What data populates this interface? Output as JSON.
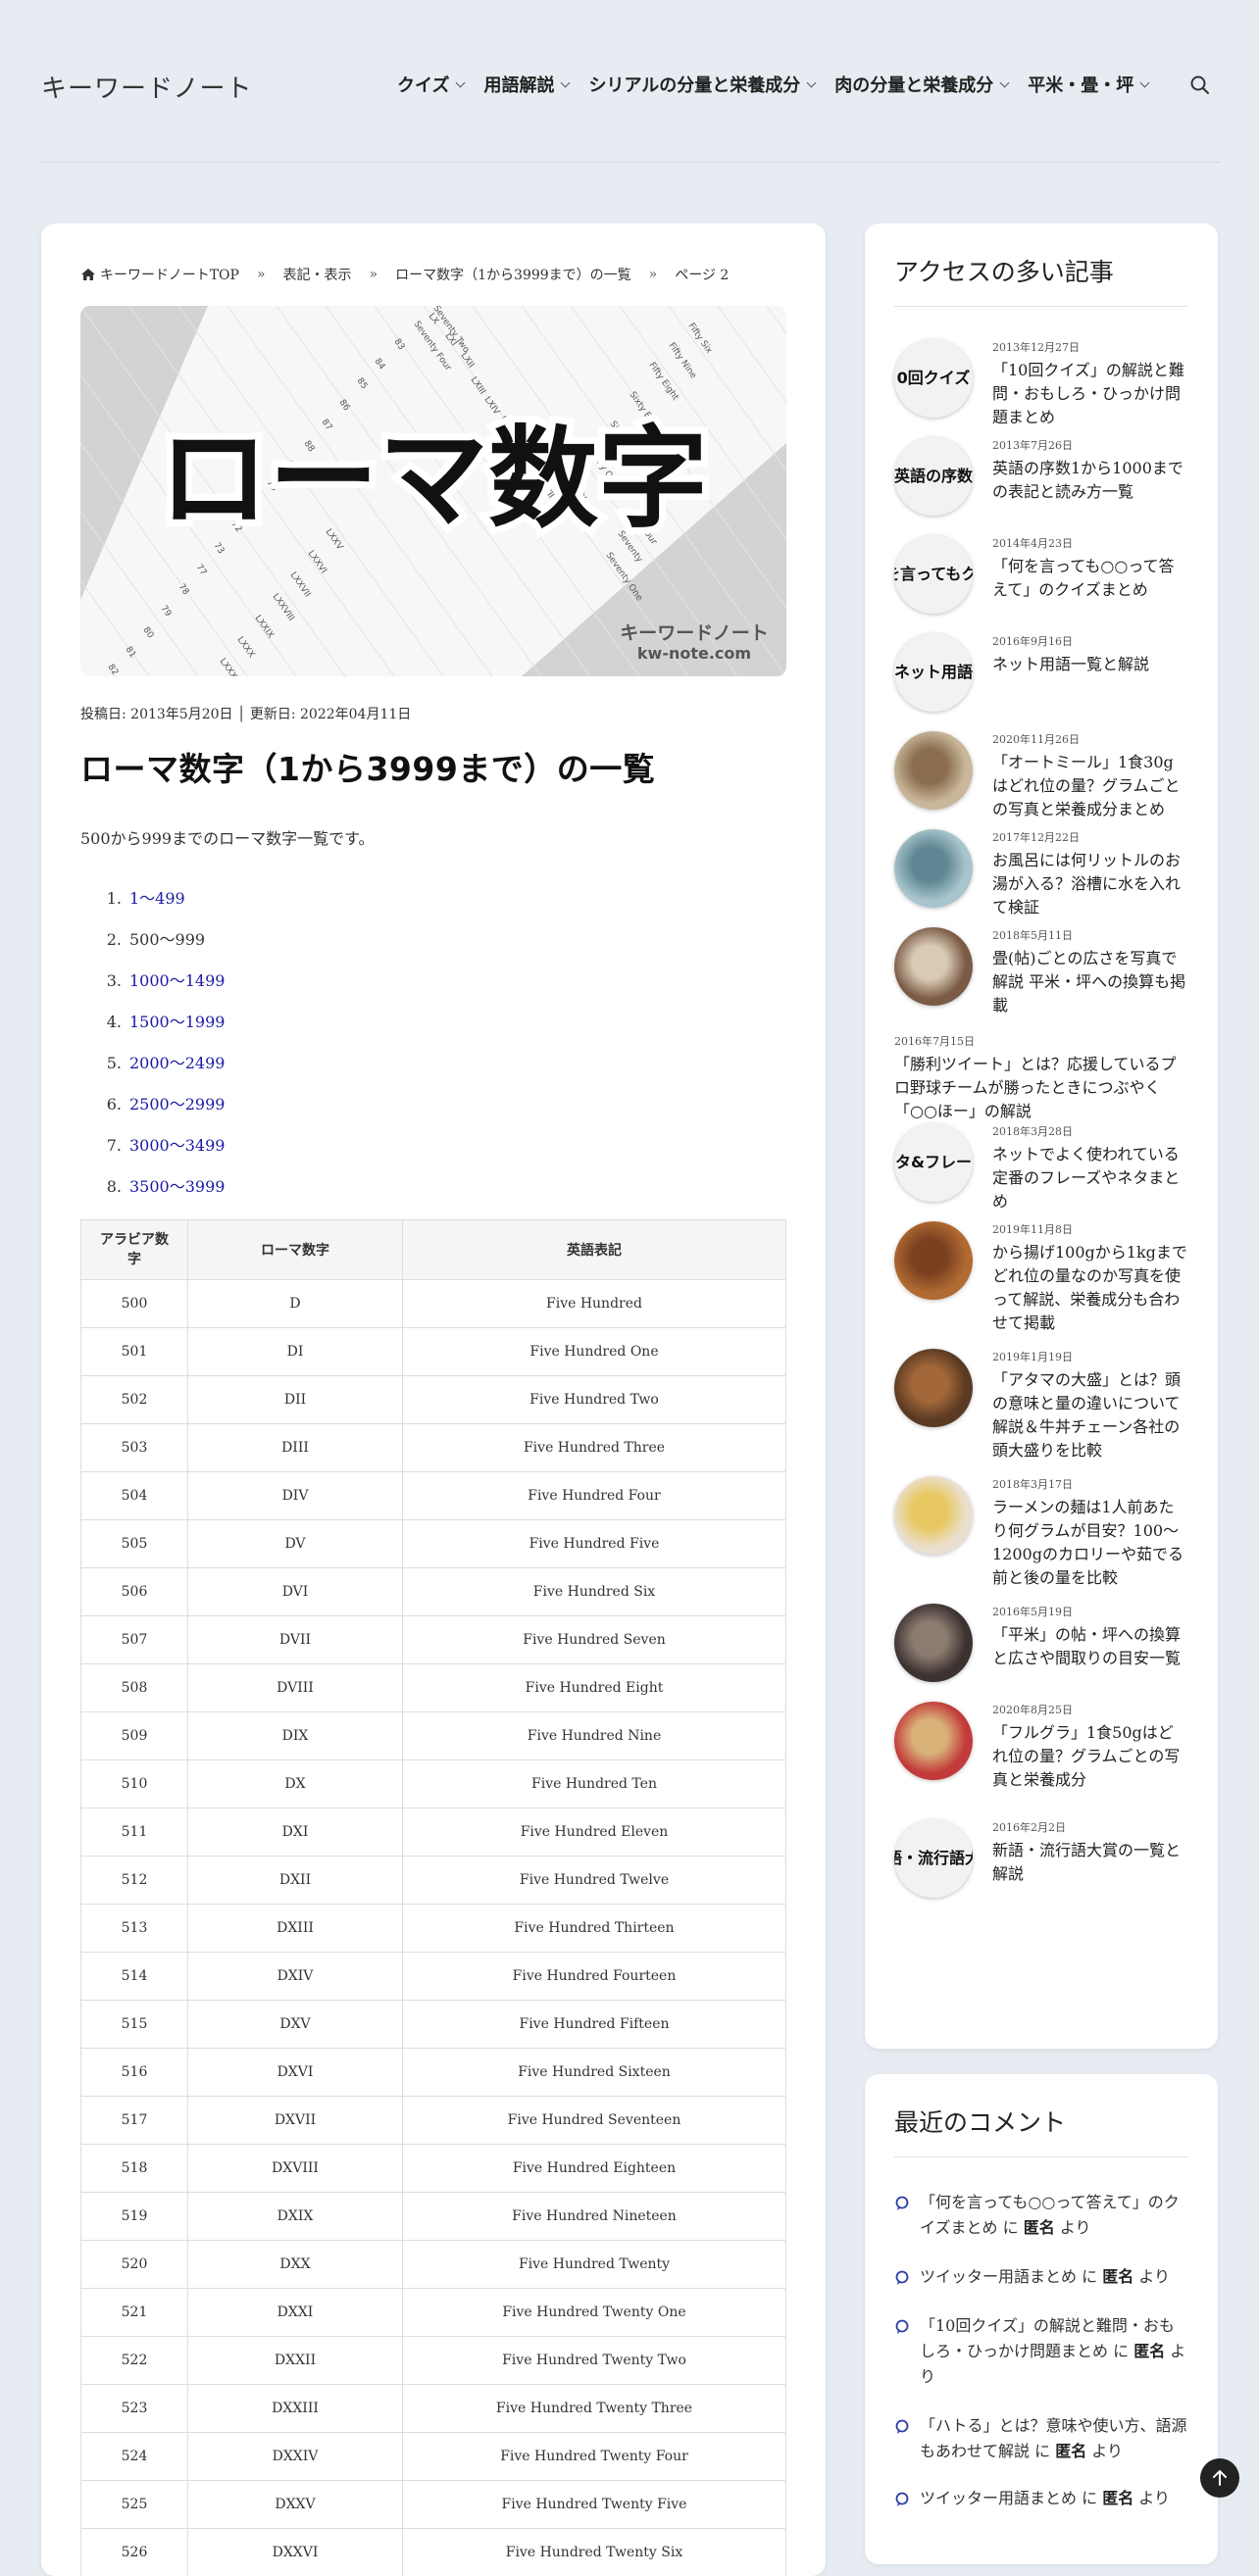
{
  "header": {
    "site_title": "キーワードノート",
    "nav": [
      "クイズ",
      "用語解説",
      "シリアルの分量と栄養成分",
      "肉の分量と栄養成分",
      "平米・畳・坪"
    ]
  },
  "breadcrumb": {
    "home": "キーワードノートTOP",
    "sep": "»",
    "items": [
      "表記・表示",
      "ローマ数字（1から3999まで）の一覧",
      "ページ 2"
    ]
  },
  "hero": {
    "title": "ローマ数字",
    "brand": "キーワードノート",
    "domain": "kw-note.com",
    "bg_words": [
      "LX",
      "LXI",
      "LXII",
      "LXIII",
      "LXIV",
      "LXV",
      "LXVI",
      "LXVII",
      "LXVIII",
      "LXIX",
      "Sixty",
      "Sixty One",
      "Sixty Two",
      "Sixty Eight",
      "Fifty Eight",
      "Fifty Nine",
      "Fifty Six",
      "Fifty Four",
      "Seventy",
      "Seventy One",
      "Seventy Two",
      "Seventy Four",
      "83",
      "84",
      "85",
      "86",
      "87",
      "88",
      "69",
      "70",
      "71",
      "72",
      "73",
      "77",
      "78",
      "79",
      "80",
      "81",
      "82",
      "LXXV",
      "LXXVI",
      "LXXVII",
      "LXXVIII",
      "LXXIX",
      "LXXX",
      "LXXXI"
    ]
  },
  "post": {
    "dates": "投稿日:  2013年5月20日 │ 更新日:  2022年04月11日",
    "title": "ローマ数字（1から3999まで）の一覧",
    "intro": "500から999までのローマ数字一覧です。",
    "ranges": [
      {
        "n": "1.",
        "label": "1～499",
        "link": true
      },
      {
        "n": "2.",
        "label": "500～999",
        "link": false
      },
      {
        "n": "3.",
        "label": "1000～1499",
        "link": true
      },
      {
        "n": "4.",
        "label": "1500～1999",
        "link": true
      },
      {
        "n": "5.",
        "label": "2000～2499",
        "link": true
      },
      {
        "n": "6.",
        "label": "2500～2999",
        "link": true
      },
      {
        "n": "7.",
        "label": "3000～3499",
        "link": true
      },
      {
        "n": "8.",
        "label": "3500～3999",
        "link": true
      }
    ]
  },
  "table": {
    "headers": [
      "アラビア数字",
      "ローマ数字",
      "英語表記"
    ],
    "rows": [
      [
        "500",
        "D",
        "Five Hundred"
      ],
      [
        "501",
        "DI",
        "Five Hundred One"
      ],
      [
        "502",
        "DII",
        "Five Hundred Two"
      ],
      [
        "503",
        "DIII",
        "Five Hundred Three"
      ],
      [
        "504",
        "DIV",
        "Five Hundred Four"
      ],
      [
        "505",
        "DV",
        "Five Hundred Five"
      ],
      [
        "506",
        "DVI",
        "Five Hundred Six"
      ],
      [
        "507",
        "DVII",
        "Five Hundred Seven"
      ],
      [
        "508",
        "DVIII",
        "Five Hundred Eight"
      ],
      [
        "509",
        "DIX",
        "Five Hundred Nine"
      ],
      [
        "510",
        "DX",
        "Five Hundred Ten"
      ],
      [
        "511",
        "DXI",
        "Five Hundred Eleven"
      ],
      [
        "512",
        "DXII",
        "Five Hundred Twelve"
      ],
      [
        "513",
        "DXIII",
        "Five Hundred Thirteen"
      ],
      [
        "514",
        "DXIV",
        "Five Hundred Fourteen"
      ],
      [
        "515",
        "DXV",
        "Five Hundred Fifteen"
      ],
      [
        "516",
        "DXVI",
        "Five Hundred Sixteen"
      ],
      [
        "517",
        "DXVII",
        "Five Hundred Seventeen"
      ],
      [
        "518",
        "DXVIII",
        "Five Hundred Eighteen"
      ],
      [
        "519",
        "DXIX",
        "Five Hundred Nineteen"
      ],
      [
        "520",
        "DXX",
        "Five Hundred Twenty"
      ],
      [
        "521",
        "DXXI",
        "Five Hundred Twenty One"
      ],
      [
        "522",
        "DXXII",
        "Five Hundred Twenty Two"
      ],
      [
        "523",
        "DXXIII",
        "Five Hundred Twenty Three"
      ],
      [
        "524",
        "DXXIV",
        "Five Hundred Twenty Four"
      ],
      [
        "525",
        "DXXV",
        "Five Hundred Twenty Five"
      ],
      [
        "526",
        "DXXVI",
        "Five Hundred Twenty Six"
      ]
    ]
  },
  "popular": {
    "heading": "アクセスの多い記事",
    "items": [
      {
        "date": "2013年12月27日",
        "title": "「10回クイズ」の解説と難問・おもしろ・ひっかけ問題まとめ",
        "thumb_text": "0回クイズ",
        "thumb": "text"
      },
      {
        "date": "2013年7月26日",
        "title": "英語の序数1から1000までの表記と読み方一覧",
        "thumb_text": "英語の序数",
        "thumb": "text"
      },
      {
        "date": "2014年4月23日",
        "title": "「何を言っても○○って答えて」のクイズまとめ",
        "thumb_text": "を言ってもクイ",
        "thumb": "text"
      },
      {
        "date": "2016年9月16日",
        "title": "ネット用語一覧と解説",
        "thumb_text": "ネット用語",
        "thumb": "text"
      },
      {
        "date": "2020年11月26日",
        "title": "「オートミール」1食30gはどれ位の量？グラムごとの写真と栄養成分まとめ",
        "thumb_text": "",
        "thumb": "oat"
      },
      {
        "date": "2017年12月22日",
        "title": "お風呂には何リットルのお湯が入る？浴槽に水を入れて検証",
        "thumb_text": "",
        "thumb": "bath"
      },
      {
        "date": "2018年5月11日",
        "title": "畳(帖)ごとの広さを写真で解説 平米・坪への換算も掲載",
        "thumb_text": "",
        "thumb": "room"
      },
      {
        "date": "2016年7月15日",
        "title": "「勝利ツイート」とは？応援しているプロ野球チームが勝ったときにつぶやく「○○ほー」の解説",
        "thumb_text": "",
        "thumb": "none"
      },
      {
        "date": "2018年3月28日",
        "title": "ネットでよく使われている定番のフレーズやネタまとめ",
        "thumb_text": "タ&フレー",
        "thumb": "text"
      },
      {
        "date": "2019年11月8日",
        "title": "から揚げ100gから1kgまでどれ位の量なのか写真を使って解説、栄養成分も合わせて掲載",
        "thumb_text": "",
        "thumb": "karaage"
      },
      {
        "date": "2019年1月19日",
        "title": "「アタマの大盛」とは？頭の意味と量の違いについて解説＆牛丼チェーン各社の頭大盛りを比較",
        "thumb_text": "",
        "thumb": "gyudon"
      },
      {
        "date": "2018年3月17日",
        "title": "ラーメンの麺は1人前あたり何グラムが目安？100～1200gのカロリーや茹でる前と後の量を比較",
        "thumb_text": "",
        "thumb": "noodle"
      },
      {
        "date": "2016年5月19日",
        "title": "「平米」の帖・坪への換算と広さや間取りの目安一覧",
        "thumb_text": "",
        "thumb": "floor"
      },
      {
        "date": "2020年8月25日",
        "title": "「フルグラ」1食50gはどれ位の量？グラムごとの写真と栄養成分",
        "thumb_text": "",
        "thumb": "granola"
      },
      {
        "date": "2016年2月2日",
        "title": "新語・流行語大賞の一覧と解説",
        "thumb_text": "語・流行語大",
        "thumb": "text"
      }
    ]
  },
  "comments": {
    "heading": "最近のコメント",
    "items": [
      {
        "article": "「何を言っても○○って答えて」のクイズまとめ",
        "mid": " に ",
        "author": "匿名",
        "tail": " より"
      },
      {
        "article": "ツイッター用語まとめ",
        "mid": " に ",
        "author": "匿名",
        "tail": " より"
      },
      {
        "article": "「10回クイズ」の解説と難問・おもしろ・ひっかけ問題まとめ",
        "mid": " に ",
        "author": "匿名",
        "tail": " より"
      },
      {
        "article": "「ハトる」とは？意味や使い方、語源もあわせて解説",
        "mid": " に ",
        "author": "匿名",
        "tail": " より"
      },
      {
        "article": "ツイッター用語まとめ",
        "mid": " に ",
        "author": "匿名",
        "tail": " より"
      }
    ]
  },
  "colors": {
    "link": "#1a1aa6",
    "background": "#e6ecf1",
    "accent_icon": "#2a3ea8"
  }
}
